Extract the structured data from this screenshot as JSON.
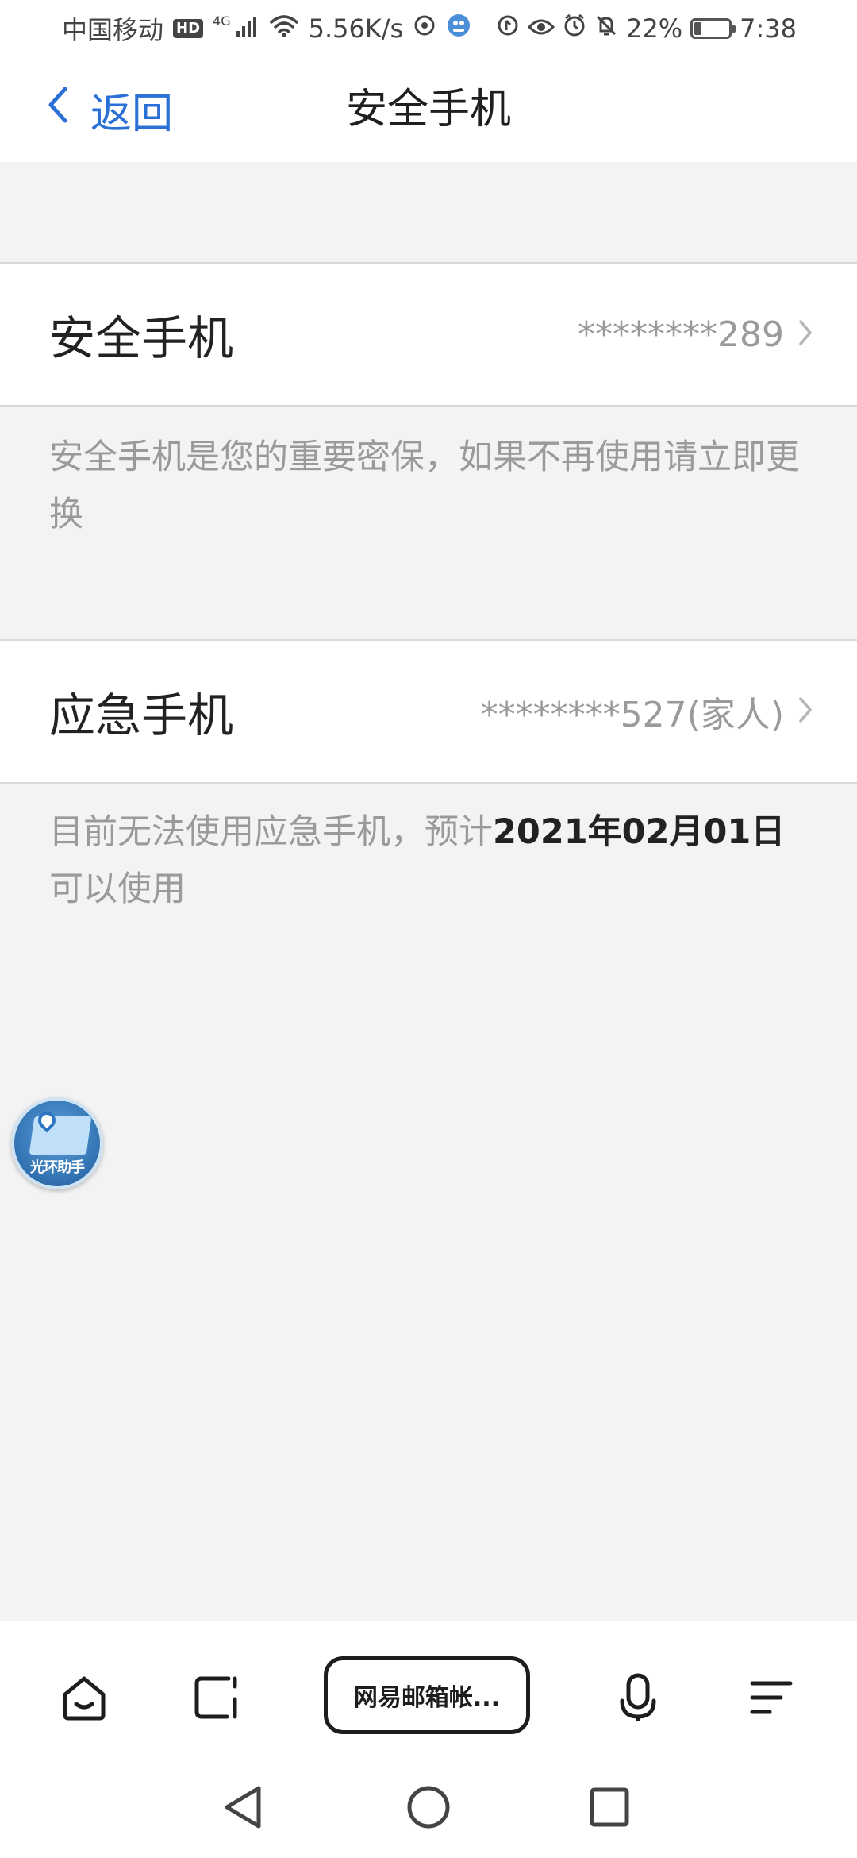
{
  "status_bar": {
    "carrier": "中国移动",
    "hd": "HD",
    "network": "4G",
    "speed": "5.56K/s",
    "battery": "22%",
    "battery_level": 0.22,
    "time": "7:38"
  },
  "header": {
    "back_label": "返回",
    "title": "安全手机"
  },
  "safe_phone": {
    "label": "安全手机",
    "value": "********289",
    "description": "安全手机是您的重要密保，如果不再使用请立即更换"
  },
  "emergency_phone": {
    "label": "应急手机",
    "value": "********527(家人)",
    "description_prefix": "目前无法使用应急手机，预计",
    "description_date": "2021年02月01日",
    "description_suffix": "可以使用"
  },
  "floating_helper": {
    "label": "光环助手"
  },
  "bottom_bar": {
    "tab_title": "网易邮箱帐..."
  },
  "colors": {
    "accent": "#2a70d6",
    "background": "#f3f3f4",
    "muted_text": "#9a9a9a"
  }
}
